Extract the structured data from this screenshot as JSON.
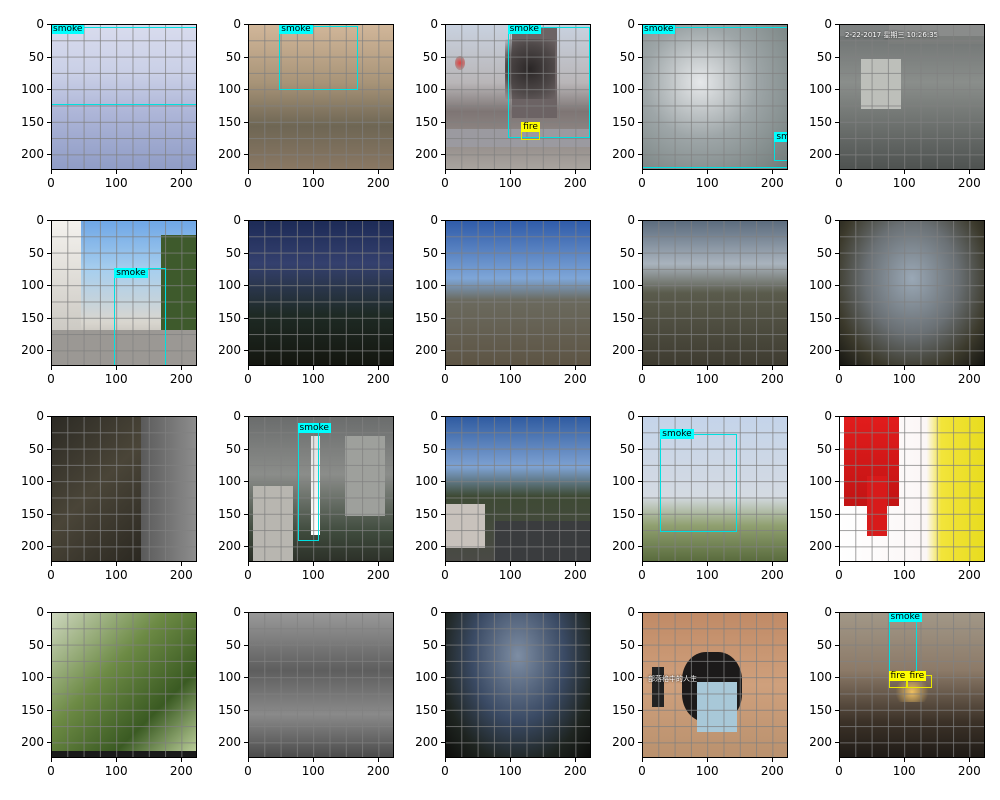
{
  "y_ticks": [
    "0",
    "50",
    "100",
    "150",
    "200"
  ],
  "x_ticks": [
    "0",
    "100",
    "200"
  ],
  "label_colors": {
    "smoke": "#00ffff",
    "fire": "#ffff00"
  },
  "panels": [
    {
      "scene": "sky with clouds and tall buildings",
      "detections": [
        {
          "label": "smoke"
        }
      ]
    },
    {
      "scene": "blurry roadside with trees",
      "detections": [
        {
          "label": "smoke"
        }
      ]
    },
    {
      "scene": "city tower with black smoke over highway",
      "detections": [
        {
          "label": "smoke"
        },
        {
          "label": "fire"
        }
      ]
    },
    {
      "scene": "blurry grey smoke close-up",
      "detections": [
        {
          "label": "smoke"
        },
        {
          "label": "sm"
        }
      ]
    },
    {
      "scene": "indoor classroom cctv",
      "overlay_text": "2-22-2017 星期三 10:26:35",
      "detections": []
    },
    {
      "scene": "street with buildings and cloud",
      "detections": [
        {
          "label": "smoke"
        }
      ]
    },
    {
      "scene": "night path with trees and lights",
      "detections": []
    },
    {
      "scene": "rocky hillside landscape",
      "detections": []
    },
    {
      "scene": "hazy valley landscape",
      "detections": []
    },
    {
      "scene": "fisheye mountain landscape",
      "detections": []
    },
    {
      "scene": "dark cave interior",
      "detections": []
    },
    {
      "scene": "city with rising smoke column",
      "detections": [
        {
          "label": "smoke"
        }
      ]
    },
    {
      "scene": "hilltop lookout with parking lot",
      "detections": []
    },
    {
      "scene": "field with faint smoke haze",
      "detections": [
        {
          "label": "smoke"
        }
      ]
    },
    {
      "scene": "red ribbon on white background",
      "detections": []
    },
    {
      "scene": "blurry green plants close-up",
      "detections": []
    },
    {
      "scene": "grayscale fence and shed",
      "detections": []
    },
    {
      "scene": "fisheye cloudy sky over forest",
      "detections": []
    },
    {
      "scene": "person sitting with phone tripod",
      "overlay_text": "部落格中的人生",
      "detections": []
    },
    {
      "scene": "dark blurred building with fire",
      "detections": [
        {
          "label": "smoke"
        },
        {
          "label": "fire"
        },
        {
          "label": "fire"
        }
      ]
    }
  ]
}
